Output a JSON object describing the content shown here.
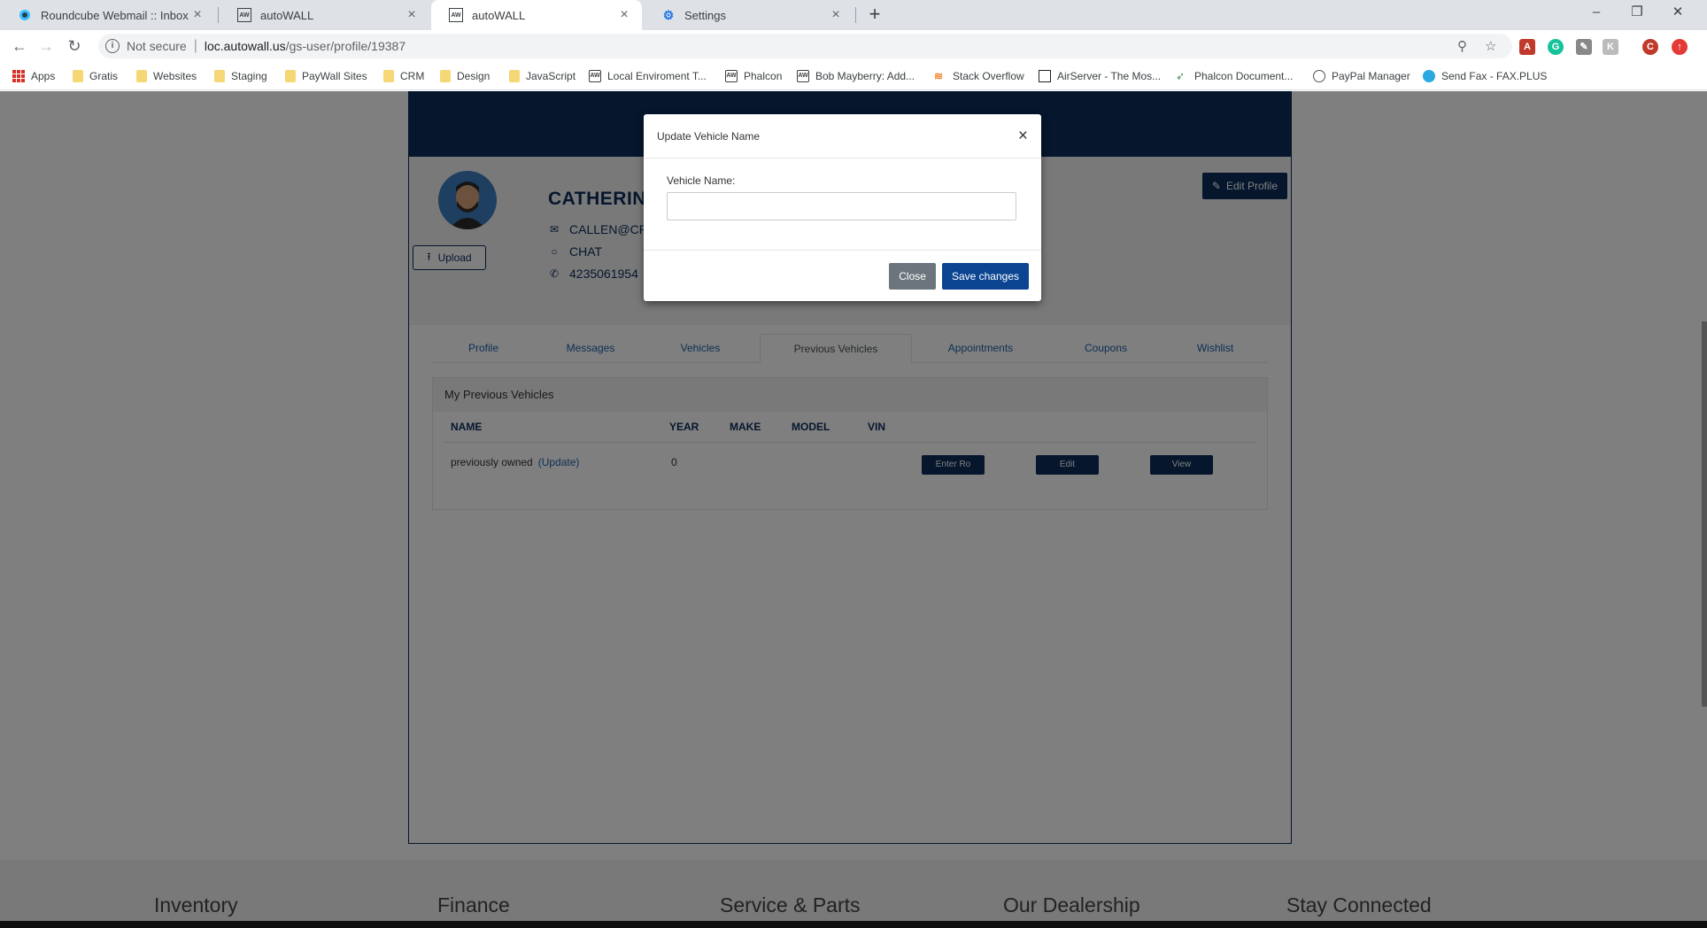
{
  "browser": {
    "tabs": [
      {
        "title": "Roundcube Webmail :: Inbox",
        "icon": "roundcube-icon"
      },
      {
        "title": "autoWALL",
        "icon": "autowall-icon"
      },
      {
        "title": "autoWALL",
        "icon": "autowall-icon"
      },
      {
        "title": "Settings",
        "icon": "gear-icon"
      }
    ],
    "active_tab_index": 2,
    "new_tab": "+",
    "window_controls": {
      "minimize": "–",
      "restore": "❐",
      "close": "✕"
    },
    "security_label": "Not secure",
    "url_host": "loc.autowall.us",
    "url_path": "/gs-user/profile/19387",
    "bookmarks": [
      {
        "label": "Apps",
        "icon": "apps-grid-icon"
      },
      {
        "label": "Gratis",
        "icon": "folder-icon"
      },
      {
        "label": "Websites",
        "icon": "folder-icon"
      },
      {
        "label": "Staging",
        "icon": "folder-icon"
      },
      {
        "label": "PayWall Sites",
        "icon": "folder-icon"
      },
      {
        "label": "CRM",
        "icon": "folder-icon"
      },
      {
        "label": "Design",
        "icon": "folder-icon"
      },
      {
        "label": "JavaScript",
        "icon": "folder-icon"
      },
      {
        "label": "Local Enviroment T...",
        "icon": "autowall-icon"
      },
      {
        "label": "Phalcon",
        "icon": "autowall-icon"
      },
      {
        "label": "Bob Mayberry: Add...",
        "icon": "autowall-icon"
      },
      {
        "label": "Stack Overflow",
        "icon": "stackoverflow-icon"
      },
      {
        "label": "AirServer - The Mos...",
        "icon": "airserver-icon"
      },
      {
        "label": "Phalcon Document...",
        "icon": "phalcon-icon"
      },
      {
        "label": "PayPal Manager",
        "icon": "paypal-icon"
      },
      {
        "label": "Send Fax - FAX.PLUS",
        "icon": "fax-icon"
      }
    ]
  },
  "profile": {
    "name": "CATHERIN",
    "email": "CALLEN@CR",
    "chat": "CHAT",
    "phone": "4235061954",
    "upload_label": "Upload",
    "edit_profile_label": "Edit Profile"
  },
  "profile_tabs": [
    "Profile",
    "Messages",
    "Vehicles",
    "Previous Vehicles",
    "Appointments",
    "Coupons",
    "Wishlist"
  ],
  "previous_vehicles": {
    "title": "My Previous Vehicles",
    "columns": [
      "NAME",
      "YEAR",
      "MAKE",
      "MODEL",
      "VIN"
    ],
    "rows": [
      {
        "name": "previously owned",
        "update_link": "(Update)",
        "year": "0",
        "make": "",
        "model": "",
        "vin": "",
        "actions": [
          "Enter Ro",
          "Edit",
          "View"
        ]
      }
    ]
  },
  "footer": {
    "columns": [
      "Inventory",
      "Finance",
      "Service & Parts",
      "Our Dealership",
      "Stay Connected"
    ]
  },
  "modal": {
    "title": "Update Vehicle Name",
    "close_x": "×",
    "field_label": "Vehicle Name:",
    "field_value": "",
    "close_label": "Close",
    "save_label": "Save changes"
  },
  "colors": {
    "brand_navy": "#0b2d5a",
    "link_blue": "#1d5fa8",
    "save_blue": "#0b4592",
    "close_gray": "#6c757d"
  }
}
